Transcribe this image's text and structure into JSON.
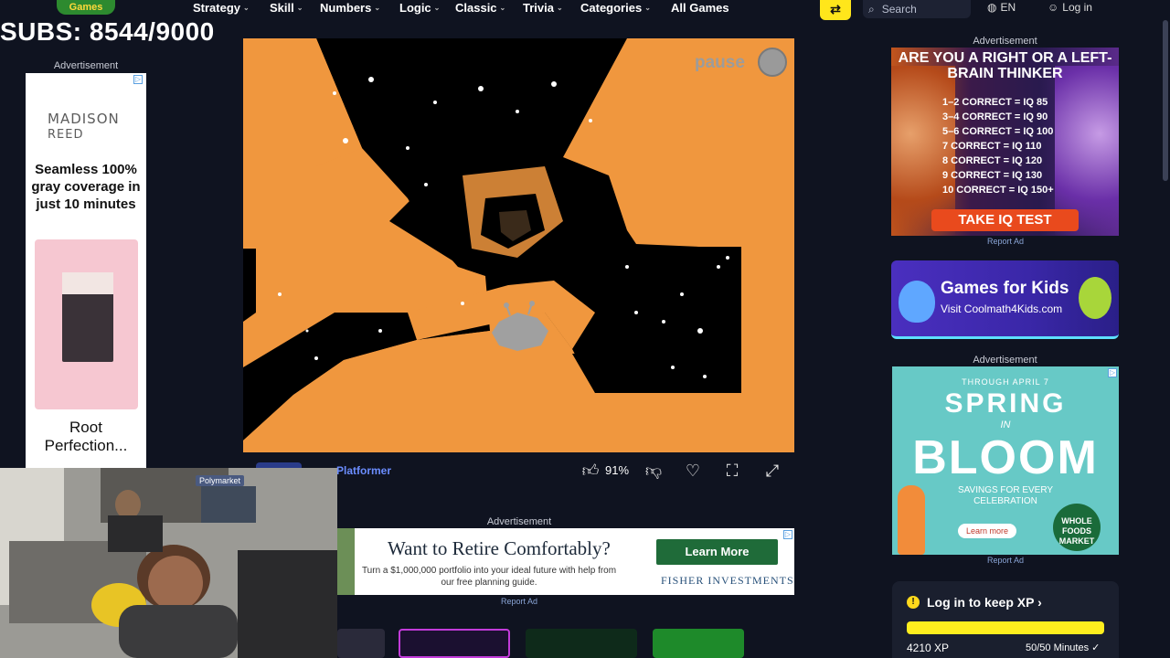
{
  "header": {
    "logo_text": "Games",
    "nav": [
      "Strategy",
      "Skill",
      "Numbers",
      "Logic",
      "Classic",
      "Trivia",
      "Categories",
      "All Games"
    ],
    "search_placeholder": "Search",
    "language": "EN",
    "login": "Log in"
  },
  "overlay": {
    "subs": "SUBS: 8544/9000"
  },
  "left_ad": {
    "label": "Advertisement",
    "brand_line1": "MADISON",
    "brand_line2": "REED",
    "headline": "Seamless 100% gray coverage in just 10 minutes",
    "footer": "Root Perfection..."
  },
  "game": {
    "pause_label": "pause",
    "title": "Platformer",
    "rating": "91%"
  },
  "bottom_ad": {
    "label": "Advertisement",
    "headline": "Want to Retire Comfortably?",
    "body": "Turn a $1,000,000 portfolio into your ideal future with help from our free planning guide.",
    "cta": "Learn More",
    "firm": "FISHER INVESTMENTS",
    "report": "Report Ad"
  },
  "iq_ad": {
    "label": "Advertisement",
    "headline": "ARE YOU A RIGHT OR A LEFT-BRAIN THINKER",
    "rows": [
      "1–2 CORRECT = IQ 85",
      "3–4 CORRECT = IQ 90",
      "5–6 CORRECT = IQ 100",
      "7 CORRECT = IQ 110",
      "8 CORRECT = IQ 120",
      "9 CORRECT = IQ 130",
      "10 CORRECT = IQ 150+"
    ],
    "cta": "TAKE IQ TEST",
    "report": "Report Ad"
  },
  "kids_ad": {
    "title": "Games for Kids",
    "subtitle": "Visit Coolmath4Kids.com"
  },
  "spring_ad": {
    "label": "Advertisement",
    "through": "THROUGH APRIL 7",
    "spring": "SPRING",
    "in": "IN",
    "bloom": "BLOOM",
    "savings": "SAVINGS FOR EVERY CELEBRATION",
    "cta": "Learn more",
    "store": "WHOLE FOODS MARKET",
    "report": "Report Ad"
  },
  "xp_card": {
    "title": "Log in to keep XP",
    "xp": "4210 XP",
    "minutes": "50/50 Minutes",
    "progress": 1.0
  },
  "webcam": {
    "sign": "Polymarket"
  }
}
